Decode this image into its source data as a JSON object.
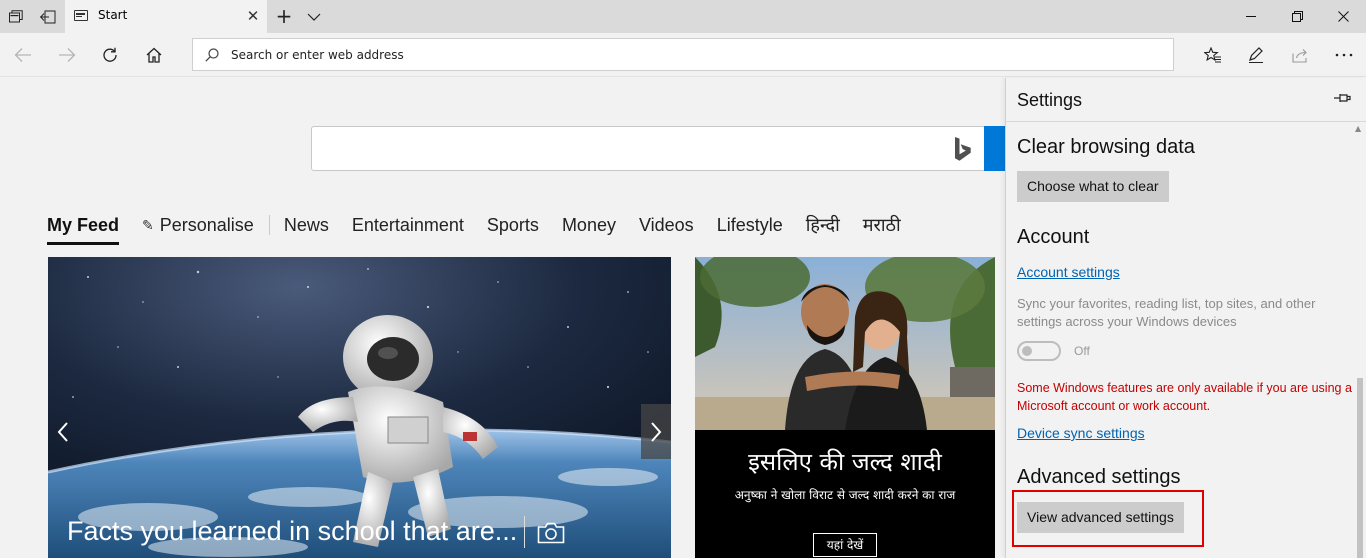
{
  "tab": {
    "title": "Start"
  },
  "address_bar": {
    "placeholder": "Search or enter web address"
  },
  "bing_search": {
    "value": ""
  },
  "feed_nav": {
    "items": [
      "My Feed",
      "Personalise",
      "News",
      "Entertainment",
      "Sports",
      "Money",
      "Videos",
      "Lifestyle",
      "हिन्दी",
      "मराठी"
    ]
  },
  "cards": {
    "main": {
      "caption": "Facts you learned in school that are..."
    },
    "side": {
      "headline": "इसलिए की जल्द शादी",
      "subtitle": "अनुष्का ने खोला विराट से जल्द शादी करने का राज",
      "button": "यहां देखें"
    }
  },
  "settings": {
    "title": "Settings",
    "clear_data": {
      "heading": "Clear browsing data",
      "button": "Choose what to clear"
    },
    "account": {
      "heading": "Account",
      "link": "Account settings",
      "sync_desc": "Sync your favorites, reading list, top sites, and other settings across your Windows devices",
      "toggle_state": "Off",
      "toggle_on": false,
      "warning": "Some Windows features are only available if you are using a Microsoft account or work account.",
      "device_sync_link": "Device sync settings"
    },
    "advanced": {
      "heading": "Advanced settings",
      "button": "View advanced settings"
    }
  },
  "colors": {
    "accent": "#0078d7",
    "link": "#0063b1",
    "warning": "#c50000",
    "highlight": "#e00000"
  },
  "icons": [
    "tab-preview-icon",
    "set-aside-tabs-icon",
    "close-icon",
    "new-tab-icon",
    "chevron-down-icon",
    "minimize-icon",
    "maximize-icon",
    "window-close-icon",
    "back-icon",
    "forward-icon",
    "refresh-icon",
    "home-icon",
    "search-icon",
    "favorites-icon",
    "pen-icon",
    "share-icon",
    "more-icon",
    "bing-icon",
    "pencil-icon",
    "chevron-left-icon",
    "chevron-right-icon",
    "camera-icon",
    "pin-icon"
  ]
}
